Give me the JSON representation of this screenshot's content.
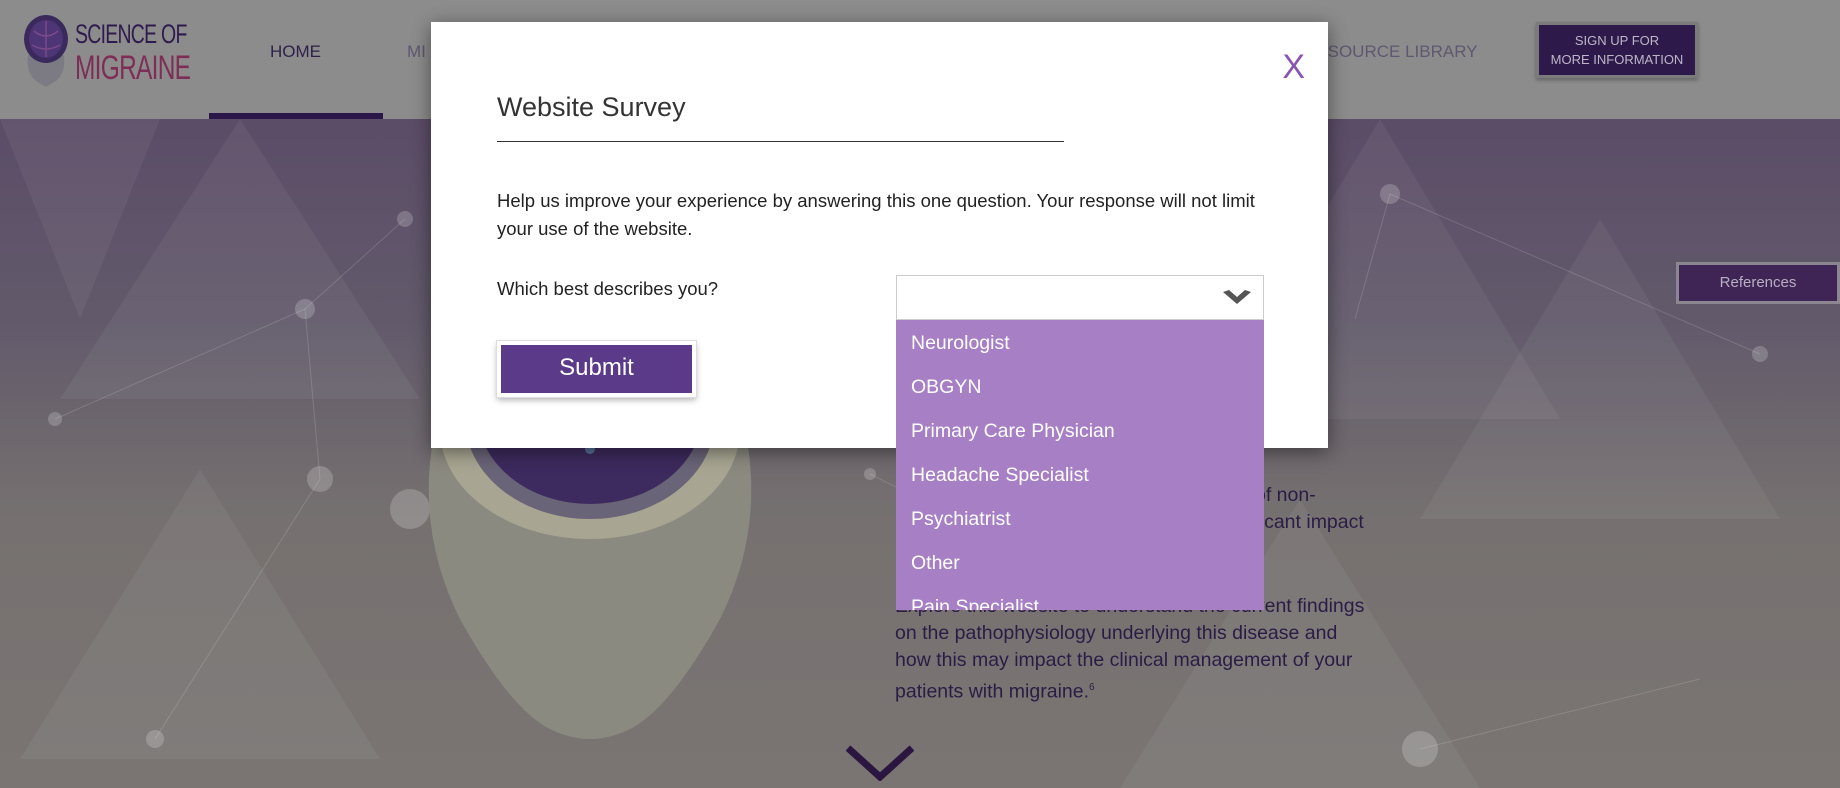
{
  "header": {
    "logo": {
      "line1": "SCIENCE OF",
      "line2": "MIGRAINE"
    },
    "nav": [
      {
        "label": "HOME",
        "active": true
      },
      {
        "label": "MI"
      },
      {
        "label": "RESOURCE LIBRARY"
      }
    ],
    "signup_line1": "SIGN UP FOR",
    "signup_line2": "MORE INFORMATION"
  },
  "hero": {
    "references_label": "References",
    "fragment1": "of non-",
    "fragment2": "ificant impact",
    "paragraph_lines": [
      "Explore this website to understand the current findings",
      "on the pathophysiology underlying this disease and",
      "how this may impact the clinical management of your",
      "patients with migraine."
    ],
    "footnote": "6"
  },
  "modal": {
    "close_label": "X",
    "title": "Website Survey",
    "description": "Help us improve your experience by answering this one question. Your response will not limit your use of the website.",
    "question": "Which best describes you?",
    "select_value": "",
    "submit_label": "Submit",
    "options": [
      "Neurologist",
      "OBGYN",
      "Primary Care Physician",
      "Headache Specialist",
      "Psychiatrist",
      "Other",
      "Pain Specialist"
    ]
  },
  "colors": {
    "accent": "#5b3a8a",
    "dropdown": "#a77fc4",
    "close": "#8a55b0"
  }
}
